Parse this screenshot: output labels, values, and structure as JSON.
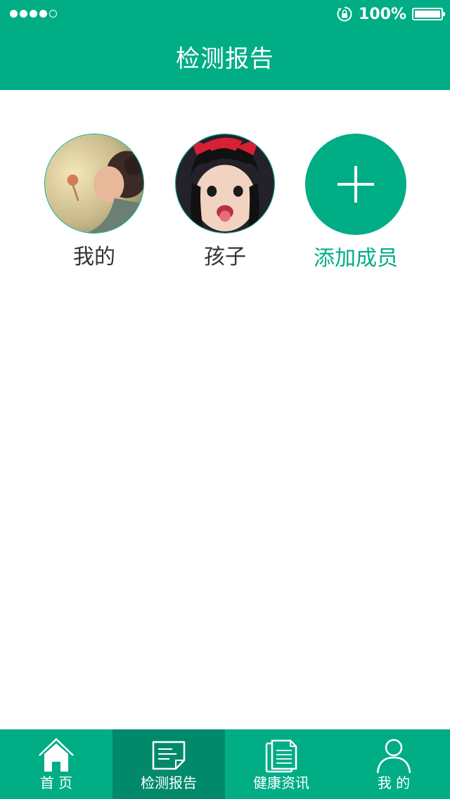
{
  "colors": {
    "accent": "#00ad85",
    "active_tab": "#008a6b",
    "text": "#333333"
  },
  "status_bar": {
    "signal_dots_filled": 4,
    "signal_dots_total": 5,
    "battery_percent": "100%",
    "icons": [
      "rotation-lock-icon",
      "battery-icon"
    ]
  },
  "header": {
    "title": "检测报告"
  },
  "members": [
    {
      "label": "我的",
      "icon": "avatar-photo"
    },
    {
      "label": "孩子",
      "icon": "avatar-photo"
    },
    {
      "label": "添加成员",
      "icon": "plus-icon"
    }
  ],
  "tabbar": {
    "active_index": 1,
    "tabs": [
      {
        "label": "首 页",
        "icon": "home-icon"
      },
      {
        "label": "检测报告",
        "icon": "report-icon"
      },
      {
        "label": "健康资讯",
        "icon": "news-icon"
      },
      {
        "label": "我 的",
        "icon": "person-icon"
      }
    ]
  }
}
